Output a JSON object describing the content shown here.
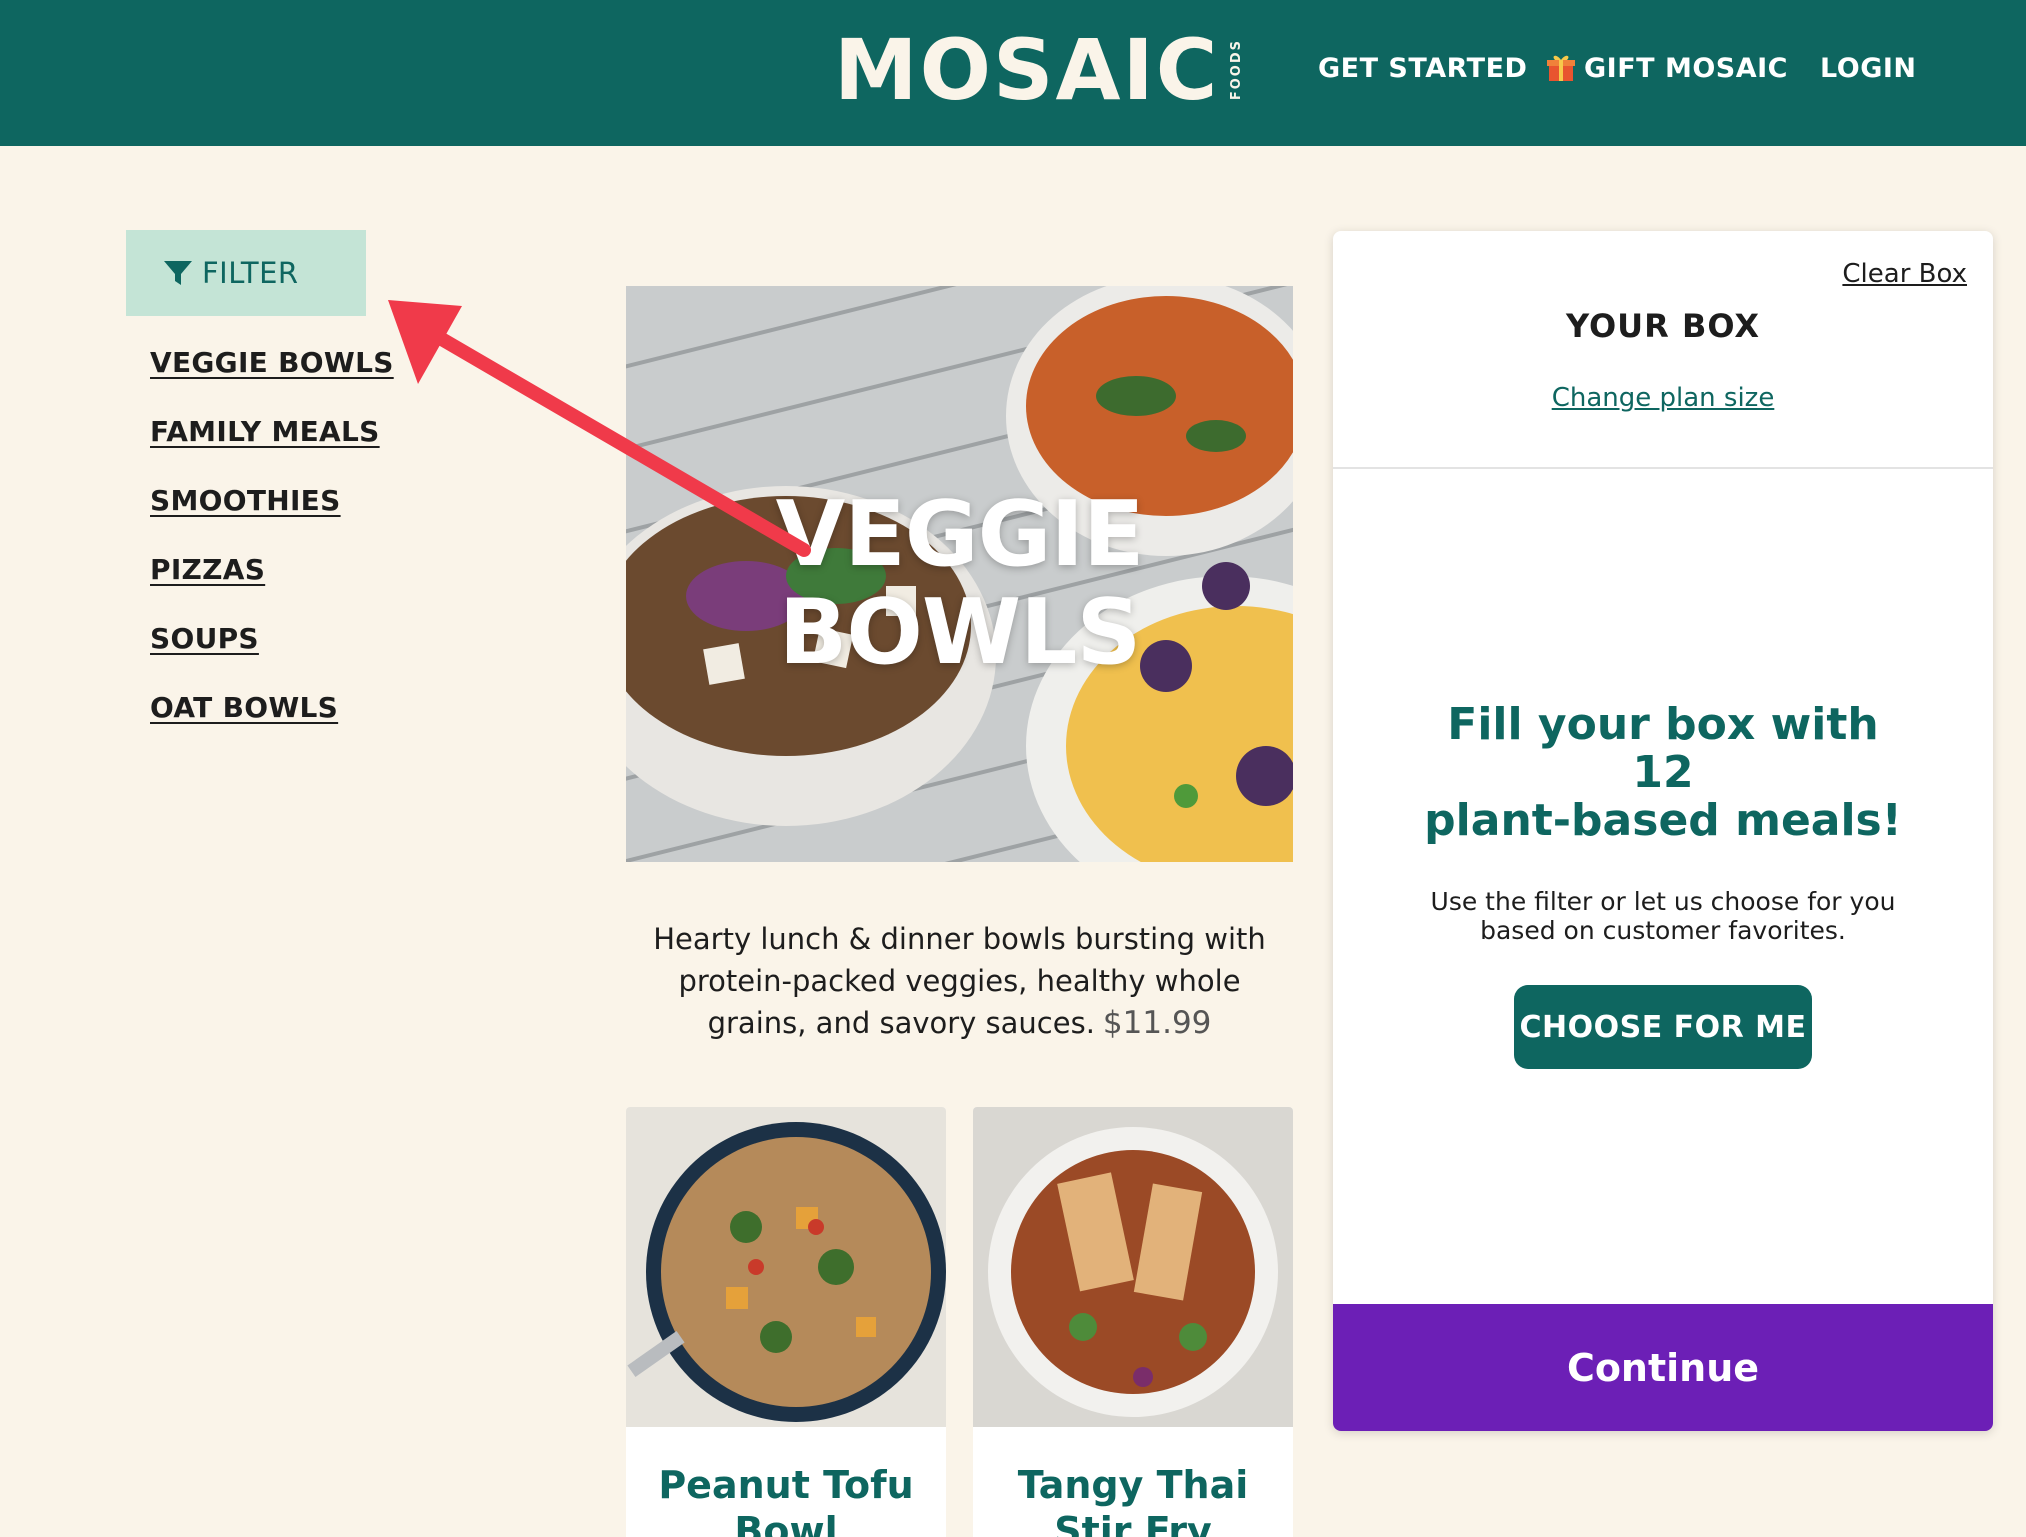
{
  "header": {
    "logo_text": "MOSAIC",
    "logo_subtext": "FOODS",
    "nav": {
      "get_started": "GET STARTED",
      "gift": "GIFT MOSAIC",
      "login": "LOGIN"
    },
    "background_color": "#0e6660"
  },
  "sidebar": {
    "filter_label": "FILTER",
    "categories": [
      "VEGGIE BOWLS",
      "FAMILY MEALS",
      "SMOOTHIES",
      "PIZZAS",
      "SOUPS",
      "OAT BOWLS"
    ]
  },
  "hero": {
    "title_line1": "VEGGIE",
    "title_line2": "BOWLS",
    "description": "Hearty lunch & dinner bowls bursting with protein-packed veggies, healthy whole grains, and savory sauces.",
    "price": "$11.99"
  },
  "products": [
    {
      "title_line1": "Peanut Tofu",
      "title_line2": "Bowl"
    },
    {
      "title_line1": "Tangy Thai",
      "title_line2": "Stir Fry"
    }
  ],
  "box": {
    "clear_label": "Clear Box",
    "title": "YOUR BOX",
    "change_plan_label": "Change plan size",
    "fill_line1": "Fill your box with",
    "fill_count": "12",
    "fill_line3": "plant-based meals!",
    "subtext": "Use the filter or let us choose for you based on customer favorites.",
    "choose_label": "CHOOSE FOR ME",
    "continue_label": "Continue"
  },
  "colors": {
    "brand_teal": "#0e6660",
    "filter_bg": "#c4e4d6",
    "page_bg": "#faf4e9",
    "continue_purple": "#6c1fb6",
    "annotation_arrow": "#f03a4a"
  }
}
